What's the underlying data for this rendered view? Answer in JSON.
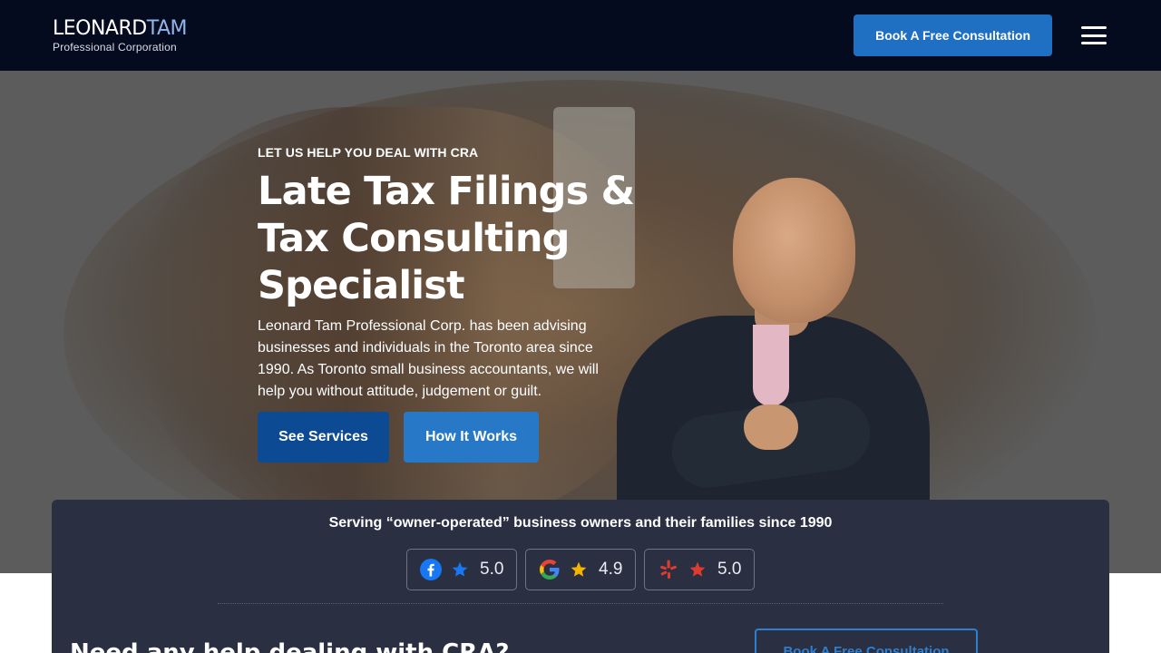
{
  "header": {
    "logo_main_first": "LEONARD",
    "logo_main_second": "TAM",
    "logo_sub": "Professional Corporation",
    "book_button": "Book A Free Consultation",
    "menu_icon": "hamburger-menu-icon"
  },
  "hero": {
    "eyebrow": "LET US HELP YOU DEAL WITH CRA",
    "title_line1": "Late Tax Filings &",
    "title_line2": "Tax Consulting",
    "title_line3": "Specialist",
    "description": "Leonard Tam Professional Corp. has been advising businesses and individuals in the Toronto area since 1990. As Toronto small business accountants, we will help you without attitude, judgement or guilt.",
    "buttons": {
      "services": "See Services",
      "how": "How It Works"
    }
  },
  "reviews": {
    "tagline": "Serving “owner-operated” business owners and their families since 1990",
    "items": [
      {
        "platform_icon": "facebook-icon",
        "rating": "5.0"
      },
      {
        "platform_icon": "google-icon",
        "rating": "4.9"
      },
      {
        "platform_icon": "yelp-icon",
        "rating": "5.0"
      }
    ]
  },
  "cta": {
    "heading": "Need any help dealing with CRA?",
    "button": "Book A Free Consultation"
  },
  "colors": {
    "header_bg": "#050b1f",
    "accent_blue": "#1f6fc3",
    "panel_bg": "#2a3042",
    "star_blue": "#1877f2",
    "star_gold": "#f5b400",
    "star_red": "#e03b2f"
  }
}
